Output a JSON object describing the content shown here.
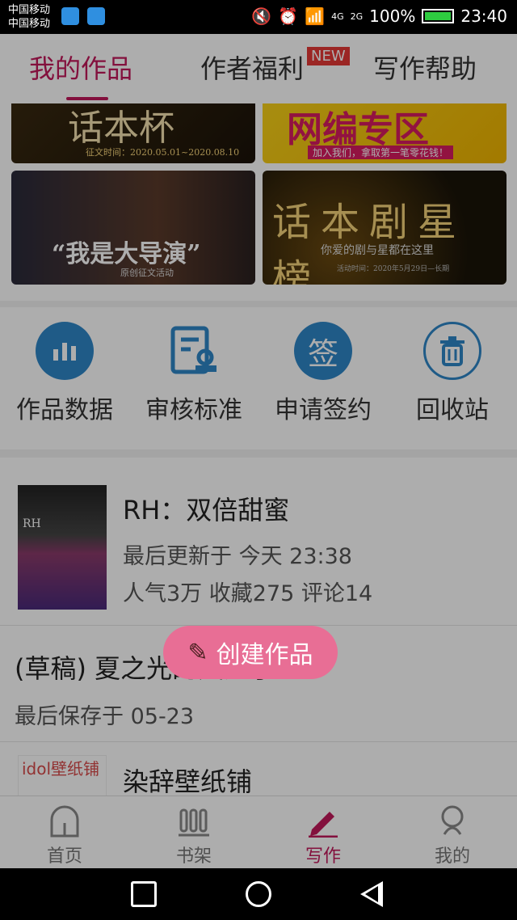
{
  "status_bar": {
    "carrier1": "中国移动",
    "carrier2": "中国移动",
    "net1": "4G",
    "net2": "2G",
    "battery": "100%",
    "time": "23:40"
  },
  "tabs": [
    {
      "label": "我的作品",
      "active": true
    },
    {
      "label": "作者福利",
      "badge": "NEW"
    },
    {
      "label": "写作帮助"
    }
  ],
  "banners": [
    {
      "title": "话本杯",
      "subtitle": "征文时间：2020.05.01~2020.08.10"
    },
    {
      "title": "网编专区",
      "subtitle": "加入我们，拿取第一笔零花钱！"
    },
    {
      "title": "“我是大导演”",
      "subtitle": "原创征文活动"
    },
    {
      "title": "话本剧星榜",
      "subtitle": "你爱的剧与星都在这里",
      "note": "活动时间：2020年5月29日—长期"
    }
  ],
  "actions": [
    {
      "label": "作品数据",
      "icon": "bar-chart-icon"
    },
    {
      "label": "审核标准",
      "icon": "document-check-icon"
    },
    {
      "label": "申请签约",
      "icon": "sign-icon",
      "icon_text": "签"
    },
    {
      "label": "回收站",
      "icon": "trash-icon"
    }
  ],
  "works": [
    {
      "title": "RH：双倍甜蜜",
      "meta1": "最后更新于 今天 23:38",
      "meta2": "人气3万 收藏275 评论14",
      "cover_text": "RH"
    },
    {
      "title": "(草稿) 夏之光的风之子",
      "meta1": "最后保存于 05-23"
    },
    {
      "title": "染辞壁纸铺",
      "cover_label": "idol壁纸铺"
    }
  ],
  "fab": {
    "label": "创建作品"
  },
  "bottom_nav": [
    {
      "label": "首页",
      "icon": "home-icon"
    },
    {
      "label": "书架",
      "icon": "bookshelf-icon"
    },
    {
      "label": "写作",
      "icon": "pen-icon",
      "active": true
    },
    {
      "label": "我的",
      "icon": "profile-icon"
    }
  ],
  "colors": {
    "accent": "#c2185b",
    "icon_blue": "#2f86c8",
    "fab": "#e86e95"
  }
}
